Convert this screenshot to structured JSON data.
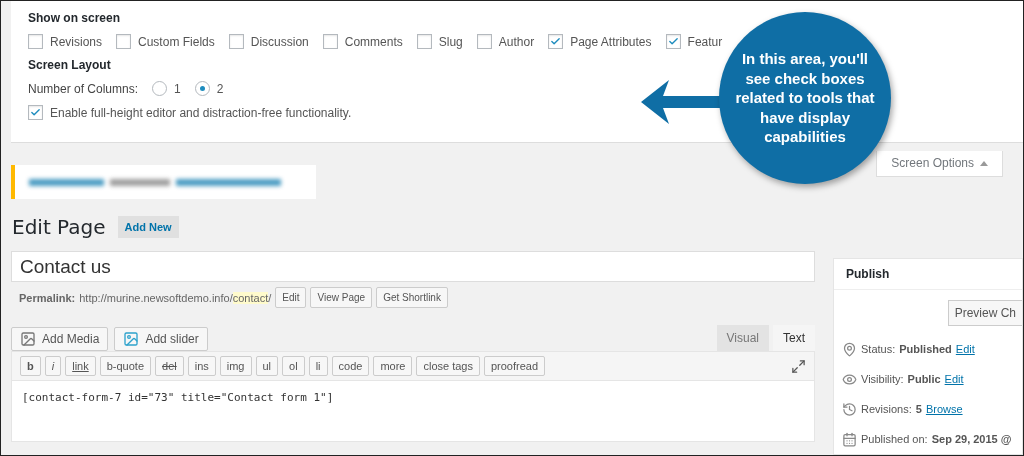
{
  "screen_options": {
    "heading": "Show on screen",
    "boxes": [
      {
        "label": "Revisions",
        "checked": false
      },
      {
        "label": "Custom Fields",
        "checked": false
      },
      {
        "label": "Discussion",
        "checked": false
      },
      {
        "label": "Comments",
        "checked": false
      },
      {
        "label": "Slug",
        "checked": false
      },
      {
        "label": "Author",
        "checked": false
      },
      {
        "label": "Page Attributes",
        "checked": true
      },
      {
        "label": "Featur",
        "checked": true
      }
    ],
    "layout_heading": "Screen Layout",
    "columns_label": "Number of Columns:",
    "columns": [
      {
        "label": "1",
        "selected": false
      },
      {
        "label": "2",
        "selected": true
      }
    ],
    "fullheight": {
      "label": "Enable full-height editor and distraction-free functionality.",
      "checked": true
    }
  },
  "callout": {
    "text": "In this area, you'll see check boxes related to tools that have display capabilities"
  },
  "screen_options_tab": {
    "label": "Screen Options",
    "expanded": true
  },
  "heading": "Edit Page",
  "add_new": "Add New",
  "post_title": "Contact us",
  "permalink": {
    "label": "Permalink:",
    "url": "http://murine.newsoftdemo.info/",
    "slug": "contact",
    "trail": "/",
    "buttons": [
      "Edit",
      "View Page",
      "Get Shortlink"
    ]
  },
  "media_buttons": [
    {
      "label": "Add Media",
      "kind": "media"
    },
    {
      "label": "Add slider",
      "kind": "slider"
    }
  ],
  "editor_tabs": [
    {
      "label": "Visual",
      "selected": false
    },
    {
      "label": "Text",
      "selected": true
    }
  ],
  "quicktags": [
    {
      "label": "b",
      "kind": "bold"
    },
    {
      "label": "i",
      "kind": "italic"
    },
    {
      "label": "link",
      "kind": "link"
    },
    {
      "label": "b-quote",
      "kind": "plain"
    },
    {
      "label": "del",
      "kind": "strike"
    },
    {
      "label": "ins",
      "kind": "plain"
    },
    {
      "label": "img",
      "kind": "plain"
    },
    {
      "label": "ul",
      "kind": "plain"
    },
    {
      "label": "ol",
      "kind": "plain"
    },
    {
      "label": "li",
      "kind": "plain"
    },
    {
      "label": "code",
      "kind": "plain"
    },
    {
      "label": "more",
      "kind": "plain"
    },
    {
      "label": "close tags",
      "kind": "plain"
    },
    {
      "label": "proofread",
      "kind": "plain"
    }
  ],
  "editor_content": "[contact-form-7 id=\"73\" title=\"Contact form 1\"]",
  "publish": {
    "title": "Publish",
    "preview_button": "Preview Ch",
    "rows": [
      {
        "kind": "status",
        "label": "Status:",
        "value": "Published",
        "link": "Edit"
      },
      {
        "kind": "visibility",
        "label": "Visibility:",
        "value": "Public",
        "link": "Edit"
      },
      {
        "kind": "revisions",
        "label": "Revisions:",
        "value": "5",
        "link": "Browse"
      },
      {
        "kind": "date",
        "label": "Published on:",
        "value": "Sep 29, 2015 @"
      }
    ]
  }
}
